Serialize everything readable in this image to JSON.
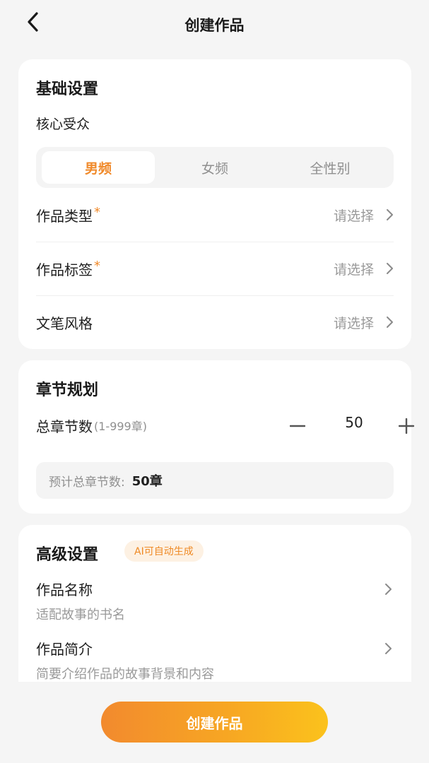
{
  "header": {
    "title": "创建作品"
  },
  "basic": {
    "title": "基础设置",
    "audience_label": "核心受众",
    "audience_options": [
      "男频",
      "女频",
      "全性别"
    ],
    "selected_audience": "男频",
    "rows": [
      {
        "label": "作品类型",
        "required": true,
        "value": "请选择"
      },
      {
        "label": "作品标签",
        "required": true,
        "value": "请选择"
      },
      {
        "label": "文笔风格",
        "required": false,
        "value": "请选择"
      }
    ],
    "required_mark": "*"
  },
  "chapters": {
    "title": "章节规划",
    "total_label": "总章节数",
    "range": "(1-999章)",
    "count": "50",
    "estimate_label": "预计总章节数:",
    "estimate_value": "50章"
  },
  "advanced": {
    "title": "高级设置",
    "badge": "AI可自动生成",
    "items": [
      {
        "title": "作品名称",
        "desc": "适配故事的书名"
      },
      {
        "title": "作品简介",
        "desc": "简要介绍作品的故事背景和内容"
      }
    ]
  },
  "footer": {
    "create_label": "创建作品"
  },
  "colors": {
    "accent": "#f08a2b",
    "background": "#f5f5f5"
  },
  "icons": {
    "back": "chevron-left-icon",
    "row": "chevron-right-icon",
    "minus": "minus-icon",
    "plus": "plus-icon"
  }
}
